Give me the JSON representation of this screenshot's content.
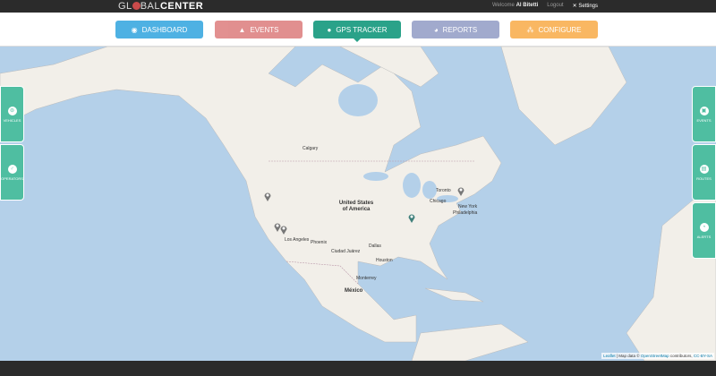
{
  "header": {
    "logo": "GLOBALCENTER",
    "logo_prefix": "GL",
    "logo_suffix_light": "BAL",
    "logo_suffix_bold": "CENTER",
    "welcome": "Welcome",
    "user": "Al Bitetti",
    "logout": "Logout",
    "settings": "Settings"
  },
  "nav": [
    {
      "label": "DASHBOARD",
      "icon": "dashboard-icon",
      "color": "#45ade2",
      "active": false
    },
    {
      "label": "EVENTS",
      "icon": "warning-icon",
      "color": "#e08a8a",
      "active": false
    },
    {
      "label": "GPS TRACKER",
      "icon": "user-pin-icon",
      "color": "#1f9e83",
      "active": true
    },
    {
      "label": "REPORTS",
      "icon": "pie-chart-icon",
      "color": "#9da6cb",
      "active": false
    },
    {
      "label": "CONFIGURE",
      "icon": "sitemap-icon",
      "color": "#f9b45a",
      "active": false
    }
  ],
  "left_panels": [
    {
      "label": "VEHICLES",
      "icon": "car-icon"
    },
    {
      "label": "OPERATORS",
      "icon": "operator-icon"
    }
  ],
  "right_panels": [
    {
      "label": "EVENTS",
      "icon": "events-icon"
    },
    {
      "label": "ROUTES",
      "icon": "routes-icon"
    },
    {
      "label": "ALERTS",
      "icon": "alerts-icon"
    }
  ],
  "map": {
    "labels": {
      "calgary": "Calgary",
      "usa": "United States of America",
      "chicago": "Chicago",
      "toronto": "Toronto",
      "newyork": "New York",
      "philadelphia": "Philadelphia",
      "losangeles": "Los Angeles",
      "phoenix": "Phoenix",
      "dallas": "Dallas",
      "houston": "Houston",
      "juarez": "Ciudad Juárez",
      "monterrey": "Monterrey",
      "mexico": "México"
    },
    "markers": 5,
    "attribution": {
      "leaflet": "Leaflet",
      "text": " | Map data © ",
      "osm": "OpenStreetMap",
      "contrib": " contributors, ",
      "license": "CC-BY-SA"
    }
  }
}
